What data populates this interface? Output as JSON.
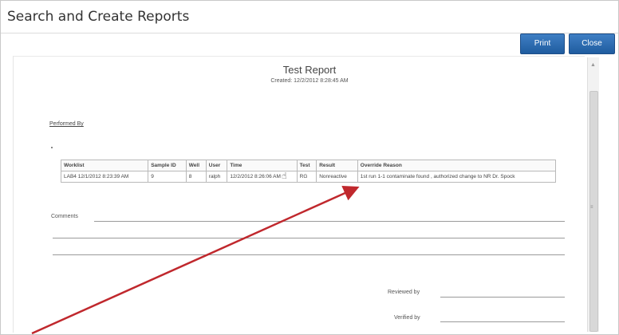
{
  "window": {
    "title": "Search and Create Reports"
  },
  "toolbar": {
    "print_label": "Print",
    "close_label": "Close"
  },
  "report": {
    "title": "Test Report",
    "created": "Created: 12/2/2012 8:28:45 AM",
    "performed_by": "Performed By",
    "table": {
      "headers": [
        "Worklist",
        "Sample ID",
        "Well",
        "User",
        "Time",
        "Test",
        "Result",
        "Override Reason"
      ],
      "rows": [
        [
          "LAB4  12/1/2012 8:23:39 AM",
          "9",
          "8",
          "ralph",
          "12/2/2012 8:26:06 AM",
          "RG",
          "Nonreactive",
          "1st run 1-1 contaminate found , authorized change to NR  Dr. Spock"
        ]
      ]
    },
    "comments_label": "Comments",
    "reviewed_label": "Reviewed by",
    "verified_label": "Verified by"
  },
  "colors": {
    "button": "#2a69ad",
    "annotation_arrow": "#c0282d"
  }
}
